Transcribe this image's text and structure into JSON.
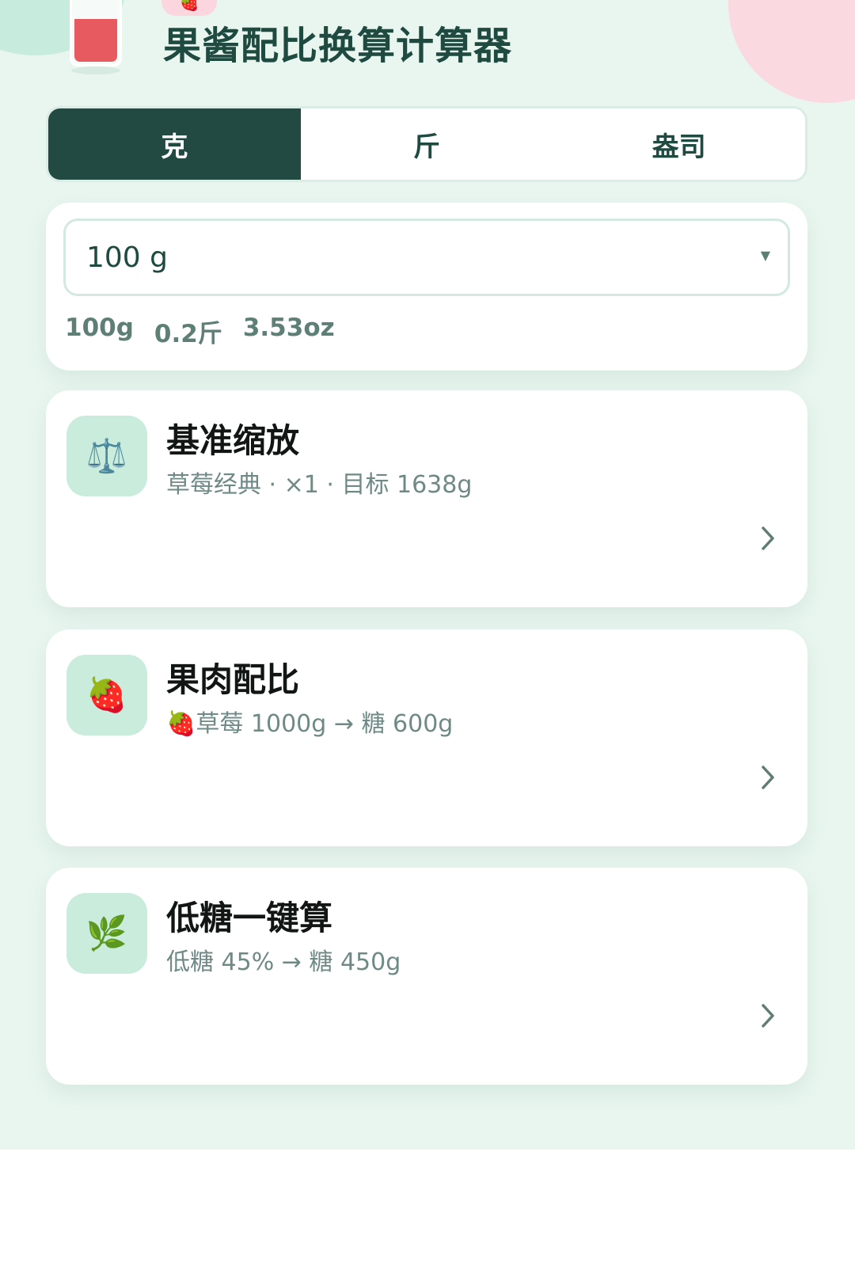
{
  "header": {
    "title": "果酱配比换算计算器",
    "badge_icon": "🍓"
  },
  "units": {
    "tabs": [
      {
        "label": "克",
        "active": true
      },
      {
        "label": "斤",
        "active": false
      },
      {
        "label": "盎司",
        "active": false
      }
    ]
  },
  "weight": {
    "selected": "100 g",
    "conversions": [
      "100g",
      "0.2斤",
      "3.53oz"
    ]
  },
  "features": [
    {
      "icon": "⚖️",
      "icon_name": "scale-icon",
      "title": "基准缩放",
      "subtitle": "草莓经典 · ×1 · 目标 1638g"
    },
    {
      "icon": "🍓",
      "icon_name": "strawberry-icon",
      "title": "果肉配比",
      "subtitle": "🍓草莓 1000g → 糖 600g"
    },
    {
      "icon": "🌿",
      "icon_name": "herb-icon",
      "title": "低糖一键算",
      "subtitle": "低糖 45% → 糖 450g"
    }
  ],
  "colors": {
    "background": "#e9f6f0",
    "primary": "#234a42",
    "icon_bg": "#c9ecdc",
    "jam_red": "#e75a5f",
    "accent_pink": "#fbd9e0"
  }
}
